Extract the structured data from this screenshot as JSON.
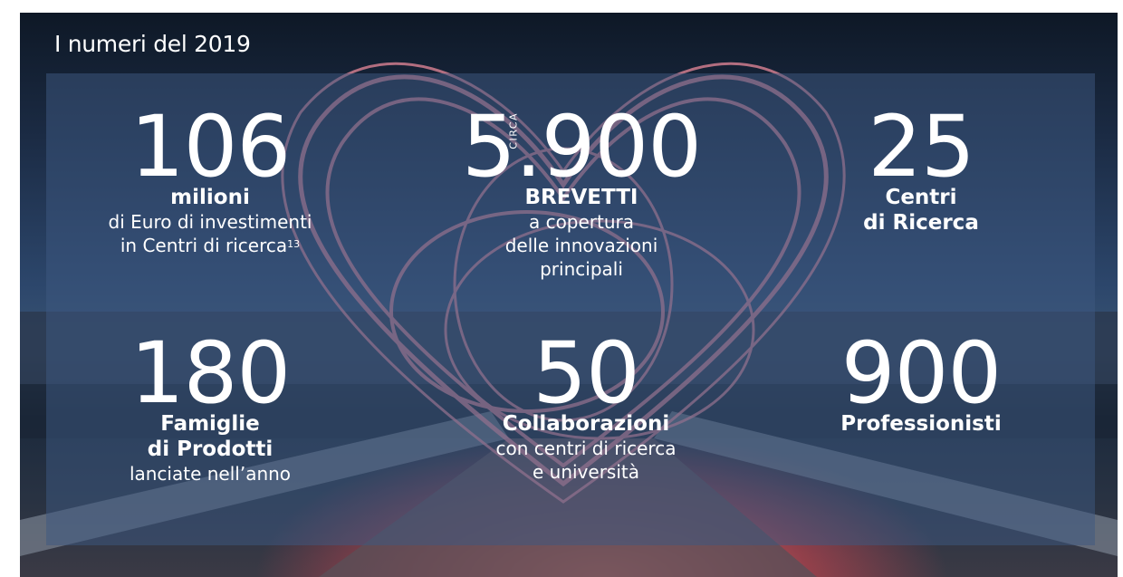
{
  "headline": "I numeri del 2019",
  "stats": [
    {
      "number": "106",
      "label": "milioni",
      "desc_line1": "di Euro di investimenti",
      "desc_line2": "in Centri di ricerca",
      "footnote": "13"
    },
    {
      "prefix": "CIRCA",
      "number": "5.900",
      "label": "BREVETTI",
      "desc_line1": "a copertura",
      "desc_line2": "delle innovazioni",
      "desc_line3": "principali"
    },
    {
      "number": "25",
      "label_line1": "Centri",
      "label_line2": "di Ricerca"
    },
    {
      "number": "180",
      "label_line1": "Famiglie",
      "label_line2": "di Prodotti",
      "desc_line1": "lanciate nell’anno"
    },
    {
      "number": "50",
      "label": "Collaborazioni",
      "desc_line1": "con centri di ricerca",
      "desc_line2": "e università"
    },
    {
      "number": "900",
      "label": "Professionisti"
    }
  ],
  "colors": {
    "text": "#ffffff",
    "panel": "#3e5880",
    "light_trail": "#e8899a"
  }
}
